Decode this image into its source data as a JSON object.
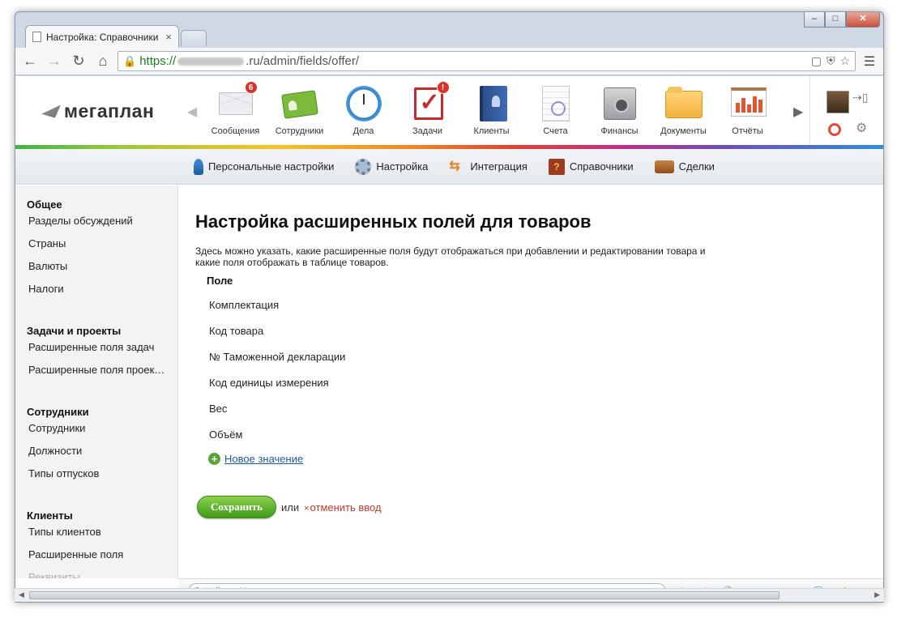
{
  "browser": {
    "tab_title": "Настройка: Справочники",
    "tab_close": "×",
    "url_scheme": "https://",
    "url_domain_suffix": ".ru",
    "url_path": "/admin/fields/offer/",
    "window_controls": {
      "minimize": "–",
      "maximize": "□",
      "close": "✕"
    }
  },
  "header": {
    "logo_text": "мегаплан",
    "apps": [
      {
        "label": "Сообщения",
        "icon": "mail-icon",
        "badge": "6"
      },
      {
        "label": "Сотрудники",
        "icon": "staff-icon",
        "badge": ""
      },
      {
        "label": "Дела",
        "icon": "clock-icon",
        "badge": ""
      },
      {
        "label": "Задачи",
        "icon": "tasks-icon",
        "badge": "!"
      },
      {
        "label": "Клиенты",
        "icon": "clients-book-icon",
        "badge": ""
      },
      {
        "label": "Счета",
        "icon": "invoice-icon",
        "badge": ""
      },
      {
        "label": "Финансы",
        "icon": "safe-icon",
        "badge": ""
      },
      {
        "label": "Документы",
        "icon": "folder-icon",
        "badge": ""
      },
      {
        "label": "Отчёты",
        "icon": "report-icon",
        "badge": ""
      }
    ]
  },
  "subnav": {
    "items": [
      {
        "label": "Персональные настройки",
        "icon": "person-settings-icon"
      },
      {
        "label": "Настройка",
        "icon": "gear-icon"
      },
      {
        "label": "Интеграция",
        "icon": "exchange-arrows-icon"
      },
      {
        "label": "Справочники",
        "icon": "reference-book-icon"
      },
      {
        "label": "Сделки",
        "icon": "briefcase-icon"
      }
    ]
  },
  "sidebar": {
    "sections": [
      {
        "title": "Общее",
        "items": [
          "Разделы обсуждений",
          "Страны",
          "Валюты",
          "Налоги"
        ]
      },
      {
        "title": "Задачи и проекты",
        "items": [
          "Расширенные поля задач",
          "Расширенные поля проек…"
        ]
      },
      {
        "title": "Сотрудники",
        "items": [
          "Сотрудники",
          "Должности",
          "Типы отпусков"
        ]
      },
      {
        "title": "Клиенты",
        "items": [
          "Типы клиентов",
          "Расширенные поля",
          "Реквизиты"
        ]
      }
    ]
  },
  "main": {
    "title": "Настройка расширенных полей для товаров",
    "description": "Здесь можно указать, какие расширенные поля будут отображаться при добавлении и редактировании товара и какие поля отображать в таблице товаров.",
    "table_header": "Поле",
    "fields": [
      "Комплектация",
      "Код товара",
      "№ Таможенной декларации",
      "Код единицы измерения",
      "Вес",
      "Объём"
    ],
    "add_link": "Новое значение",
    "save_label": "Сохранить",
    "or_text": "или",
    "cancel_label": "отменить ввод"
  },
  "footer": {
    "search_placeholder": "Найти в Мегаплане",
    "favorites_count": "3",
    "hot_count": "4",
    "comments_count": "44",
    "alerts_count": "152"
  },
  "colors": {
    "save_green": "#3f9a19",
    "link_blue": "#1d5aa3",
    "cancel_red": "#c0392b",
    "badge_red": "#d9322a"
  }
}
